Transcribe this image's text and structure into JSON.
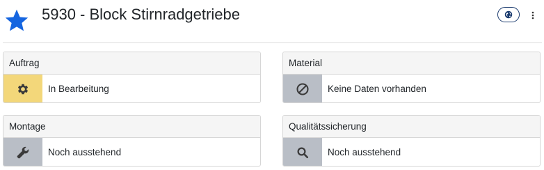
{
  "header": {
    "title": "5930 - Block Stirnradgetriebe",
    "star_icon": "star-icon",
    "globe_icon": "globe-icon",
    "menu_icon": "kebab-menu-icon",
    "star_color": "#1565e0"
  },
  "cards": [
    {
      "title": "Auftrag",
      "status": "In Bearbeitung",
      "icon": "gear-icon",
      "icon_bg": "#f3d77a"
    },
    {
      "title": "Material",
      "status": "Keine Daten vorhanden",
      "icon": "ban-icon",
      "icon_bg": "#b9bec6"
    },
    {
      "title": "Montage",
      "status": "Noch ausstehend",
      "icon": "wrench-icon",
      "icon_bg": "#b9bec6"
    },
    {
      "title": "Qualitätssicherung",
      "status": "Noch ausstehend",
      "icon": "search-icon",
      "icon_bg": "#b9bec6"
    }
  ]
}
